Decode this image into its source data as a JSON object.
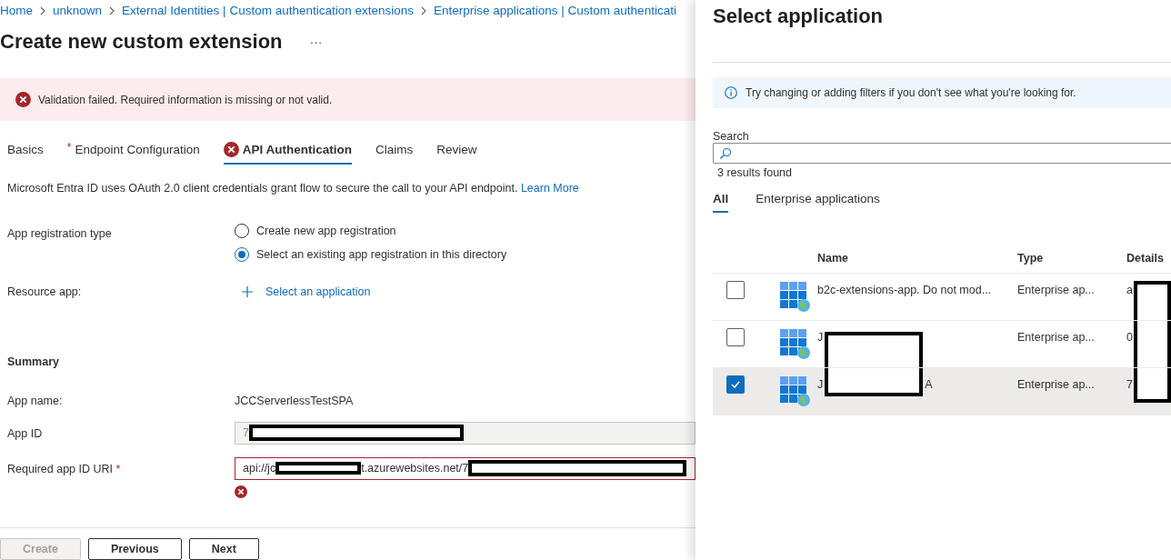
{
  "breadcrumb": [
    "Home",
    "unknown",
    "External Identities | Custom authentication extensions",
    "Enterprise applications | Custom authenticati"
  ],
  "page": {
    "title": "Create new custom extension",
    "more": "···"
  },
  "error_banner": {
    "message": "Validation failed. Required information is missing or not valid."
  },
  "tabs": [
    {
      "label": "Basics",
      "selected": false,
      "required": false,
      "error": false
    },
    {
      "label": "Endpoint Configuration",
      "selected": false,
      "required": true,
      "error": false
    },
    {
      "label": "API Authentication",
      "selected": true,
      "required": false,
      "error": true
    },
    {
      "label": "Claims",
      "selected": false,
      "required": false,
      "error": false
    },
    {
      "label": "Review",
      "selected": false,
      "required": false,
      "error": false
    }
  ],
  "description": {
    "text": "Microsoft Entra ID uses OAuth 2.0 client credentials grant flow to secure the call to your API endpoint.",
    "link": "Learn More"
  },
  "app_registration_type": {
    "label": "App registration type",
    "options": [
      {
        "label": "Create new app registration",
        "selected": false
      },
      {
        "label": "Select an existing app registration in this directory",
        "selected": true
      }
    ]
  },
  "resource_app": {
    "label": "Resource app:",
    "action": "Select an application"
  },
  "summary": {
    "heading": "Summary",
    "app_name_label": "App name:",
    "app_name": "JCCServerlessTestSPA",
    "app_id_label": "App ID",
    "app_id_visible": "7",
    "uri_label": "Required app ID URI",
    "uri_required_mark": "*",
    "uri_start": "api://jc",
    "uri_middle": "t.azurewebsites.net/7",
    "uri_error": true
  },
  "footer_buttons": [
    {
      "label": "Create",
      "disabled": true
    },
    {
      "label": "Previous",
      "disabled": false
    },
    {
      "label": "Next",
      "disabled": false
    }
  ],
  "panel": {
    "title": "Select application",
    "info": "Try changing or adding filters if you don't see what you're looking for.",
    "search_label": "Search",
    "results": "3 results found",
    "tabs": [
      {
        "label": "All",
        "selected": true
      },
      {
        "label": "Enterprise applications",
        "selected": false
      }
    ],
    "columns": [
      "Name",
      "Type",
      "Details"
    ],
    "rows": [
      {
        "name_start": "b2c-extensions-app. Do not mod...",
        "name_end": "",
        "type": "Enterprise ap...",
        "details": "a",
        "selected": false
      },
      {
        "name_start": "J",
        "name_end": "",
        "type": "Enterprise ap...",
        "details": "0",
        "selected": false
      },
      {
        "name_start": "J",
        "name_end": "A",
        "type": "Enterprise ap...",
        "details": "7",
        "selected": true
      }
    ]
  }
}
